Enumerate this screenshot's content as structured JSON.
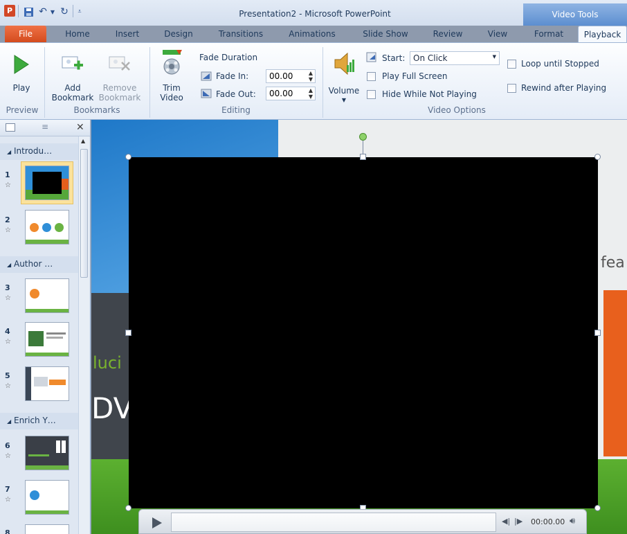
{
  "window": {
    "title": "Presentation2 - Microsoft PowerPoint",
    "context_header": "Video Tools"
  },
  "tabs": [
    {
      "label": "File"
    },
    {
      "label": "Home"
    },
    {
      "label": "Insert"
    },
    {
      "label": "Design"
    },
    {
      "label": "Transitions"
    },
    {
      "label": "Animations"
    },
    {
      "label": "Slide Show"
    },
    {
      "label": "Review"
    },
    {
      "label": "View"
    },
    {
      "label": "Format"
    },
    {
      "label": "Playback"
    }
  ],
  "ribbon": {
    "preview": {
      "group": "Preview",
      "play": "Play"
    },
    "bookmarks": {
      "group": "Bookmarks",
      "add_1": "Add",
      "add_2": "Bookmark",
      "remove_1": "Remove",
      "remove_2": "Bookmark"
    },
    "editing": {
      "group": "Editing",
      "trim_1": "Trim",
      "trim_2": "Video",
      "fade_duration": "Fade Duration",
      "fade_in_label": "Fade In:",
      "fade_in_value": "00.00",
      "fade_out_label": "Fade Out:",
      "fade_out_value": "00.00"
    },
    "video_options": {
      "group": "Video Options",
      "volume": "Volume",
      "start_label": "Start:",
      "start_value": "On Click",
      "play_full_screen": "Play Full Screen",
      "hide_while_not_playing": "Hide While Not Playing",
      "loop_until_stopped": "Loop until Stopped",
      "rewind_after_playing": "Rewind after Playing"
    }
  },
  "slides_panel": {
    "sections": [
      "Introdu…",
      "Author …",
      "Enrich Y…"
    ],
    "slide_numbers": [
      "1",
      "2",
      "3",
      "4",
      "5",
      "6",
      "7",
      "8"
    ]
  },
  "slide": {
    "partial_text_1": "fea",
    "partial_text_2": "luci",
    "partial_text_3": "DV"
  },
  "player": {
    "time": "00:00.00"
  }
}
